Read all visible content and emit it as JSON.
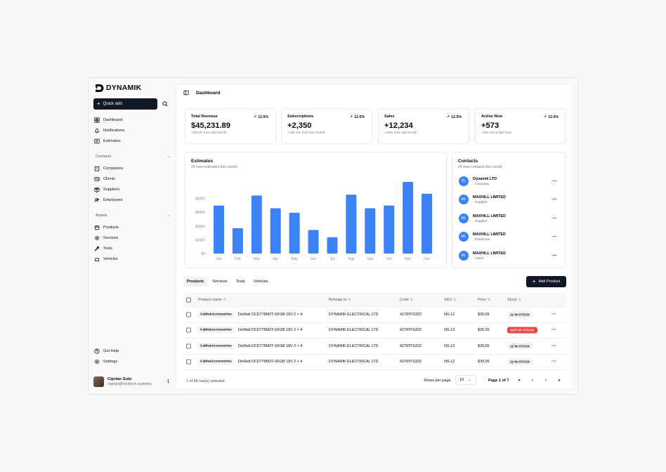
{
  "brand": {
    "name": "DYNAMIK"
  },
  "sidebar": {
    "quick_add": "Quick add",
    "main_items": [
      {
        "label": "Dashboard",
        "icon": "grid-icon"
      },
      {
        "label": "Notifications",
        "icon": "bell-icon"
      },
      {
        "label": "Estimates",
        "icon": "receipt-icon"
      }
    ],
    "contacts_section": "Contacts",
    "contacts_items": [
      {
        "label": "Companies",
        "icon": "building-icon"
      },
      {
        "label": "Clients",
        "icon": "id-card-icon"
      },
      {
        "label": "Suppliers",
        "icon": "box-icon"
      },
      {
        "label": "Employees",
        "icon": "users-icon"
      }
    ],
    "assets_section": "Assets",
    "assets_items": [
      {
        "label": "Products",
        "icon": "package-icon"
      },
      {
        "label": "Services",
        "icon": "settings-icon"
      },
      {
        "label": "Tools",
        "icon": "wrench-icon"
      },
      {
        "label": "Vehicles",
        "icon": "car-icon"
      }
    ],
    "bottom_items": [
      {
        "label": "Get Help",
        "icon": "help-icon"
      },
      {
        "label": "Settings",
        "icon": "gear-icon"
      }
    ],
    "user": {
      "name": "Ciprian Sutu",
      "email": "ciprian@novitech.systems"
    }
  },
  "header": {
    "title": "Dashboard"
  },
  "stats": [
    {
      "label": "Total Revenue",
      "change": "12.5%",
      "value": "$45,231.89",
      "sub": "+20.1% from last month"
    },
    {
      "label": "Subscriptions",
      "change": "12.5%",
      "value": "+2,350",
      "sub": "+180.1% from last month"
    },
    {
      "label": "Sales",
      "change": "12.5%",
      "value": "+12,234",
      "sub": "+19% from last month"
    },
    {
      "label": "Active Now",
      "change": "12.5%",
      "value": "+573",
      "sub": "+201 since last hour"
    }
  ],
  "estimates": {
    "title": "Estimates",
    "subtitle": "25 new estimates this month"
  },
  "chart_data": {
    "type": "bar",
    "categories": [
      "Jan",
      "Feb",
      "Mar",
      "Apr",
      "May",
      "Jun",
      "Jul",
      "Aug",
      "Sep",
      "Oct",
      "Nov",
      "Dec"
    ],
    "values": [
      5300,
      2800,
      6400,
      5000,
      4500,
      2600,
      1800,
      6500,
      5000,
      5300,
      7900,
      6600
    ],
    "yticks": [
      "$6000",
      "$4500",
      "$3000",
      "$1500",
      "$0"
    ],
    "ylim": [
      0,
      8000
    ],
    "grid": false,
    "color": "#3b82f6"
  },
  "contacts": {
    "title": "Contacts",
    "subtitle": "25 new contacts this month",
    "items": [
      {
        "initials": "DL",
        "name": "Dynamik LTD",
        "role": "Company"
      },
      {
        "initials": "ML",
        "name": "MAXHILL LIMITED",
        "role": "Supplier"
      },
      {
        "initials": "ML",
        "name": "MAXHILL LIMITED",
        "role": "Supplier"
      },
      {
        "initials": "ML",
        "name": "MAXHILL LIMITED",
        "role": "Employee"
      },
      {
        "initials": "ML",
        "name": "MAXHILL LIMITED",
        "role": "Client"
      }
    ]
  },
  "tabs": [
    "Products",
    "Services",
    "Tools",
    "Vehicles"
  ],
  "add_product": "Add Product",
  "table": {
    "columns": [
      "Product name",
      "Belongs to",
      "Code",
      "SKU",
      "Price",
      "Stock"
    ],
    "rows": [
      {
        "category": "Cable&Accessories",
        "product": "DeWalt DCD778M2T-SFGB 18V 2 × 4",
        "belongs": "DYNAMIK ELECTRICAL LTD",
        "code": "4278TFS322",
        "sku": "NS-12",
        "price": "$39,99",
        "stock": "22 IN STOCK",
        "status": "in"
      },
      {
        "category": "Cable&Accessories",
        "product": "DeWalt DCD778M2T-SFGB 18V 2 × 4",
        "belongs": "DYNAMIK ELECTRICAL LTD",
        "code": "4278TFS322",
        "sku": "NS-13",
        "price": "$39,99",
        "stock": "OUT OF STOCK",
        "status": "out"
      },
      {
        "category": "Cable&Accessories",
        "product": "DeWalt DCD778M2T-SFGB 18V 2 × 4",
        "belongs": "DYNAMIK ELECTRICAL LTD",
        "code": "4278TFS322",
        "sku": "NS-12",
        "price": "$39,99",
        "stock": "22 IN STOCK",
        "status": "in"
      },
      {
        "category": "Cable&Accessories",
        "product": "DeWalt DCD778M2T-SFGB 18V 2 × 4",
        "belongs": "DYNAMIK ELECTRICAL LTD",
        "code": "4278TFS322",
        "sku": "NS-12",
        "price": "$39,99",
        "stock": "22 IN STOCK",
        "status": "in"
      }
    ]
  },
  "footer": {
    "selected": "1 of 68 row(s) selected.",
    "rows_per_page_label": "Rows per page",
    "rows_per_page": "10",
    "page": "Page 1 of 7"
  }
}
